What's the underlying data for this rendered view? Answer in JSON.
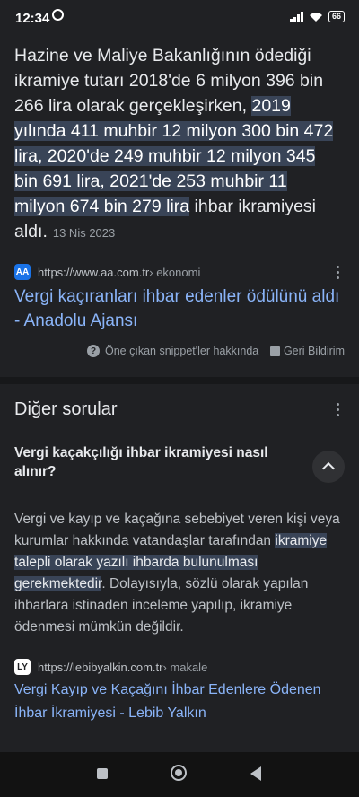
{
  "status_bar": {
    "time": "12:34",
    "battery": "66"
  },
  "snippet": {
    "text_plain": "Hazine ve Maliye Bakanlığının ödediği ikramiye tutarı 2018'de 6 milyon 396 bin 266 lira olarak gerçekleşirken, ",
    "text_highlight": "2019 yılında 411 muhbir 12 milyon 300 bin 472 lira, 2020'de 249 muhbir 12 milyon 345 bin 691 lira, 2021'de 253 muhbir 11 milyon 674 bin 279 lira",
    "text_tail": " ihbar ikramiyesi aldı.",
    "date": "13 Nis 2023"
  },
  "source1": {
    "url": "https://www.aa.com.tr",
    "path": " › ekonomi",
    "title": "Vergi kaçıranları ihbar edenler ödülünü aldı - Anadolu Ajansı"
  },
  "feedback": {
    "about_label": "Öne çıkan snippet'ler hakkında",
    "feedback_label": "Geri Bildirim"
  },
  "other_questions": {
    "title": "Diğer sorular",
    "question": "Vergi kaçakçılığı ihbar ikramiyesi nasıl alınır?",
    "answer_plain": "Vergi ve kayıp ve kaçağına sebebiyet veren kişi veya kurumlar hakkında vatandaşlar tarafından ",
    "answer_highlight": "ikramiye talepli olarak yazılı ihbarda bulunulması gerekmektedir",
    "answer_tail": ". Dolayısıyla, sözlü olarak yapılan ihbarlara istinaden inceleme yapılıp, ikramiye ödenmesi mümkün değildir."
  },
  "source2": {
    "url": "https://lebibyalkin.com.tr",
    "path": " › makale",
    "title": "Vergi Kayıp ve Kaçağını İhbar Edenlere Ödenen İhbar İkramiyesi - Lebib Yalkın"
  },
  "icons": {
    "aa_favicon": "AA",
    "lebib_favicon": "LY"
  },
  "colors": {
    "link": "#8ab4f8",
    "highlight": "#394457",
    "background": "#202124"
  }
}
